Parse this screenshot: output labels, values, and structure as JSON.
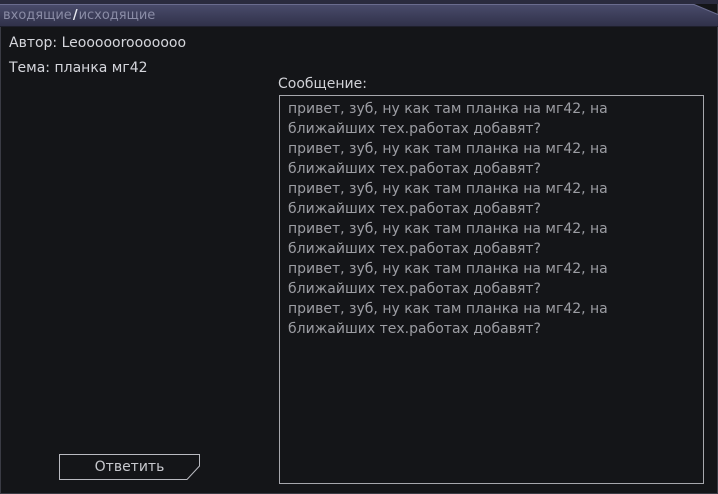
{
  "tabs": {
    "inbox": "входящие",
    "separator": "/",
    "outbox": "исходящие"
  },
  "message": {
    "author_label": "Автор:",
    "author": "Leooooorooooooo",
    "subject_label": "Тема:",
    "subject": "планка мг42",
    "body_label": "Сообщение:",
    "body": "привет, зуб, ну как там планка на мг42, на ближайших тех.работах добавят?\nпривет, зуб, ну как там планка на мг42, на ближайших тех.работах добавят?\nпривет, зуб, ну как там планка на мг42, на ближайших тех.работах добавят?\nпривет, зуб, ну как там планка на мг42, на ближайших тех.работах добавят?\nпривет, зуб, ну как там планка на мг42, на ближайших тех.работах добавят?\nпривет, зуб, ну как там планка на мг42, на ближайших тех.работах добавят?"
  },
  "actions": {
    "reply_label": "Ответить"
  },
  "colors": {
    "background": "#141518",
    "header": "#3b3d5a",
    "tab_text": "#8a8ca6",
    "border": "#a6a7ad"
  }
}
